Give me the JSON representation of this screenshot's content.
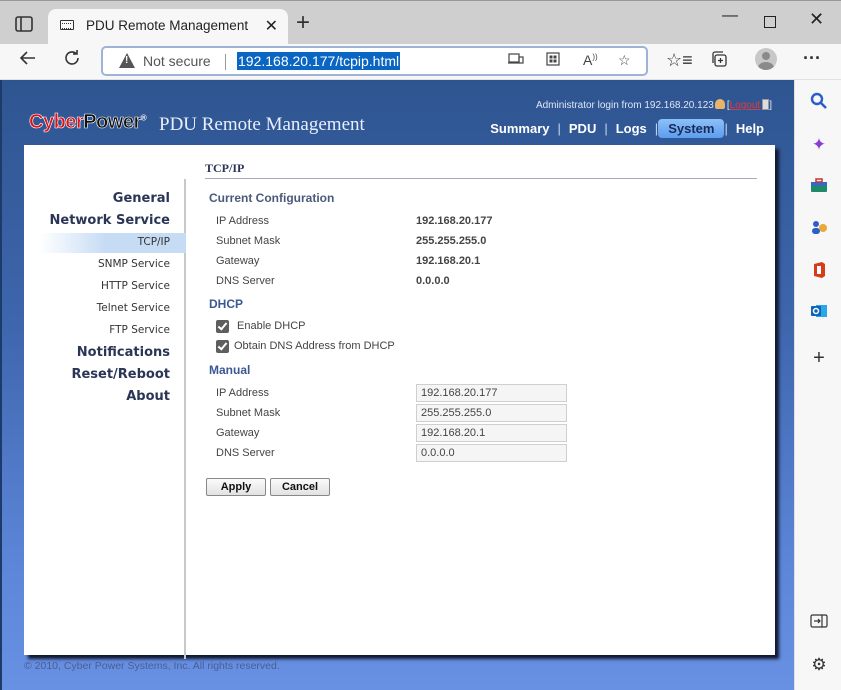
{
  "browser": {
    "tab_title": "PDU Remote Management",
    "tab_close_glyph": "✕",
    "new_tab_glyph": "+",
    "security_label": "Not secure",
    "url": "192.168.20.177/tcpip.html",
    "window_controls": {
      "minimize": "—",
      "close": "✕"
    },
    "more_glyph": "···"
  },
  "edge_sidebar": {
    "items": [
      {
        "name": "search",
        "glyph": "🔍",
        "color": "#2a5ec9"
      },
      {
        "name": "copilot",
        "glyph": "✦",
        "color": "#8a3ad9"
      },
      {
        "name": "tools",
        "glyph": "🧰",
        "color": "#2a8a6a"
      },
      {
        "name": "people",
        "glyph": "👥",
        "color": "#2a5ec9"
      },
      {
        "name": "office",
        "glyph": "◧",
        "color": "#d83b1a"
      },
      {
        "name": "outlook",
        "glyph": "✉",
        "color": "#1f73c8"
      },
      {
        "name": "add",
        "glyph": "+",
        "color": "#333333"
      }
    ],
    "bottom": {
      "hide_sidebar_glyph": "⇥",
      "settings_glyph": "⚙"
    }
  },
  "header": {
    "logo_cyber": "Cyber",
    "logo_power": "Power",
    "logo_mark": "®",
    "app_title": "PDU Remote Management",
    "login_text": "Administrator login from 192.168.20.123",
    "logout_open": "[",
    "logout_label": "Logout",
    "logout_close": "]",
    "nav": [
      {
        "label": "Summary",
        "active": false
      },
      {
        "label": "PDU",
        "active": false
      },
      {
        "label": "Logs",
        "active": false
      },
      {
        "label": "System",
        "active": true
      },
      {
        "label": "Help",
        "active": false
      }
    ],
    "nav_separator": "|"
  },
  "sidebar": {
    "items": [
      {
        "label": "General",
        "level": "main"
      },
      {
        "label": "Network Service",
        "level": "main"
      },
      {
        "label": "TCP/IP",
        "level": "sub",
        "active": true
      },
      {
        "label": "SNMP Service",
        "level": "sub"
      },
      {
        "label": "HTTP Service",
        "level": "sub"
      },
      {
        "label": "Telnet Service",
        "level": "sub"
      },
      {
        "label": "FTP Service",
        "level": "sub"
      },
      {
        "label": "Notifications",
        "level": "main"
      },
      {
        "label": "Reset/Reboot",
        "level": "main"
      },
      {
        "label": "About",
        "level": "main"
      }
    ]
  },
  "main": {
    "section_title": "TCP/IP",
    "current": {
      "heading": "Current Configuration",
      "rows": [
        {
          "label": "IP Address",
          "value": "192.168.20.177"
        },
        {
          "label": "Subnet Mask",
          "value": "255.255.255.0"
        },
        {
          "label": "Gateway",
          "value": "192.168.20.1"
        },
        {
          "label": "DNS Server",
          "value": "0.0.0.0"
        }
      ]
    },
    "dhcp": {
      "heading": "DHCP",
      "options": [
        {
          "label": "Enable DHCP",
          "checked": true
        },
        {
          "label": "Obtain DNS Address from DHCP",
          "checked": true
        }
      ]
    },
    "manual": {
      "heading": "Manual",
      "rows": [
        {
          "label": "IP Address",
          "value": "192.168.20.177"
        },
        {
          "label": "Subnet Mask",
          "value": "255.255.255.0"
        },
        {
          "label": "Gateway",
          "value": "192.168.20.1"
        },
        {
          "label": "DNS Server",
          "value": "0.0.0.0"
        }
      ]
    },
    "buttons": {
      "apply": "Apply",
      "cancel": "Cancel"
    }
  },
  "footer": {
    "copyright": "© 2010, Cyber Power Systems, Inc. All rights reserved."
  }
}
